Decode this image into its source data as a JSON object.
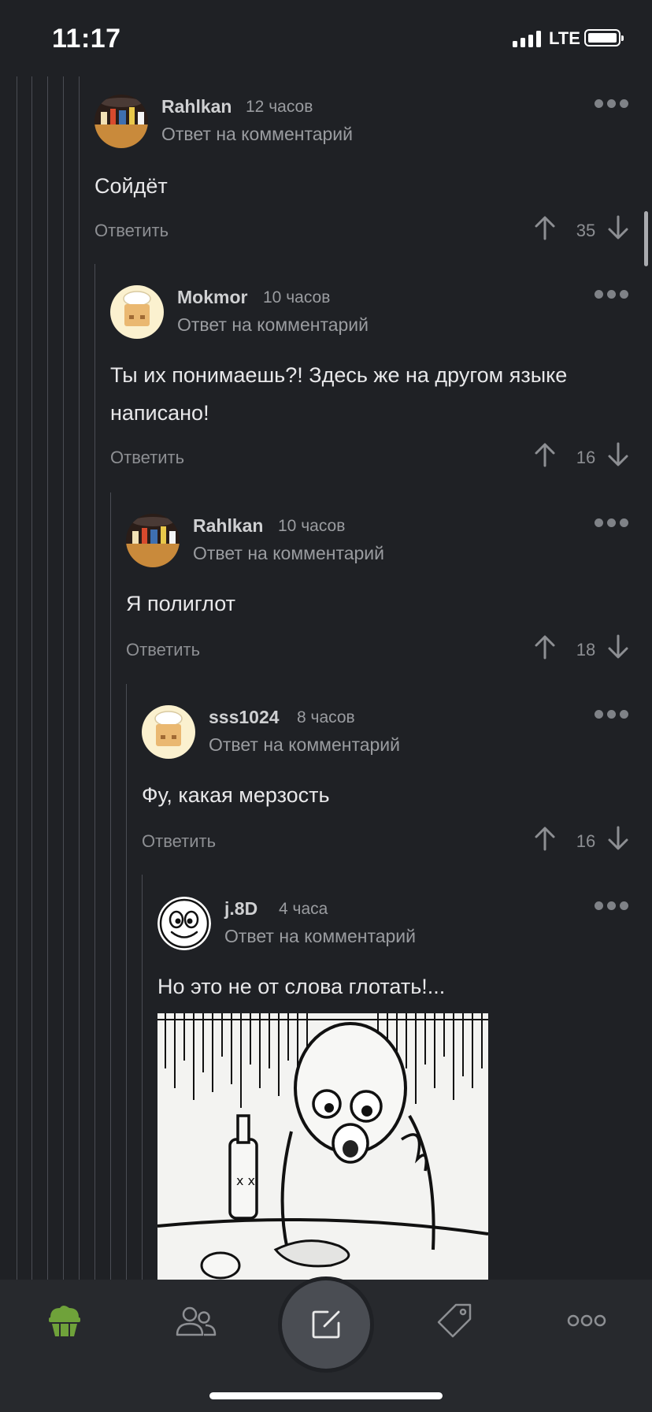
{
  "status_bar": {
    "time": "11:17",
    "network": "LTE"
  },
  "comments": [
    {
      "author": "Rahlkan",
      "time": "12 часов",
      "subline": "Ответ на комментарий",
      "text": [
        "Сойдёт"
      ],
      "reply_label": "Ответить",
      "score": "35"
    },
    {
      "author": "Mokmor",
      "time": "10 часов",
      "subline": "Ответ на комментарий",
      "text": [
        "Ты их понимаешь?! Здесь же на другом языке",
        "написано!"
      ],
      "reply_label": "Ответить",
      "score": "16"
    },
    {
      "author": "Rahlkan",
      "time": "10 часов",
      "subline": "Ответ на комментарий",
      "text": [
        "Я полиглот"
      ],
      "reply_label": "Ответить",
      "score": "18"
    },
    {
      "author": "sss1024",
      "time": "8 часов",
      "subline": "Ответ на комментарий",
      "text": [
        "Фу, какая мерзость"
      ],
      "reply_label": "Ответить",
      "score": "16"
    },
    {
      "author": "j.8D",
      "time": "4 часа",
      "subline": "Ответ на комментарий",
      "text": [
        "Но это не от слова глотать!..."
      ]
    }
  ],
  "tabbar": {
    "items": [
      {
        "icon": "cupcake-icon",
        "active": true
      },
      {
        "icon": "users-icon"
      },
      {
        "icon": "compose-icon"
      },
      {
        "icon": "tag-icon"
      },
      {
        "icon": "more-icon"
      }
    ],
    "active_color": "#6fa23a"
  }
}
